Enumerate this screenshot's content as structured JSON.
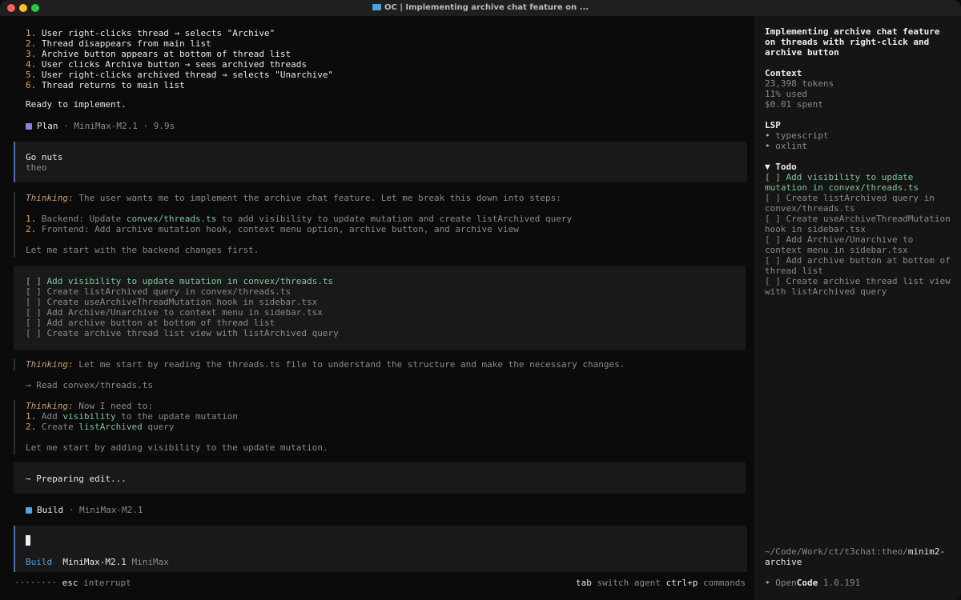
{
  "window": {
    "title": "OC | Implementing archive chat feature on ..."
  },
  "steps": [
    {
      "n": "1.",
      "t": "User right-clicks thread → selects \"Archive\""
    },
    {
      "n": "2.",
      "t": "Thread disappears from main list"
    },
    {
      "n": "3.",
      "t": "Archive button appears at bottom of thread list"
    },
    {
      "n": "4.",
      "t": "User clicks Archive button → sees archived threads"
    },
    {
      "n": "5.",
      "t": "User right-clicks archived thread → selects \"Unarchive\""
    },
    {
      "n": "6.",
      "t": "Thread returns to main list"
    }
  ],
  "ready": "Ready to implement.",
  "plan_meta": {
    "label": "Plan",
    "sep": " · ",
    "model": "MiniMax-M2.1",
    "time": " · 9.9s"
  },
  "user_msg": {
    "text": "Go nuts",
    "author": "theo"
  },
  "thinking1": {
    "prefix": "Thinking:",
    "text": " The user wants me to implement the archive chat feature. Let me break this down into steps:",
    "s1_num": "1.",
    "s1_a": " Backend: Update ",
    "s1_code": "convex/threads.ts",
    "s1_b": " to add visibility to update mutation and create listArchived query",
    "s2_num": "2.",
    "s2_text": " Frontend: Add archive mutation hook, context menu option, archive button, and archive view",
    "tail": "Let me start with the backend changes first."
  },
  "todos_main": [
    "[ ] Add visibility to update mutation in convex/threads.ts",
    "[ ] Create listArchived query in convex/threads.ts",
    "[ ] Create useArchiveThreadMutation hook in sidebar.tsx",
    "[ ] Add Archive/Unarchive to context menu in sidebar.tsx",
    "[ ] Add archive button at bottom of thread list",
    "[ ] Create archive thread list view with listArchived query"
  ],
  "thinking2": {
    "prefix": "Thinking:",
    "text": " Let me start by reading the threads.ts file to understand the structure and make the necessary changes."
  },
  "read_line": "→ Read convex/threads.ts",
  "thinking3": {
    "prefix": "Thinking:",
    "text": " Now I need to:",
    "s1_num": "1.",
    "s1_a": " Add ",
    "s1_code": "visibility",
    "s1_b": " to the update mutation",
    "s2_num": "2.",
    "s2_a": " Create ",
    "s2_code": "listArchived",
    "s2_b": " query",
    "tail": "Let me start by adding visibility to the update mutation."
  },
  "preparing": "~ Preparing edit...",
  "build_meta": {
    "label": "Build",
    "sep": " · ",
    "model": "MiniMax-M2.1"
  },
  "input": {
    "mode": "Build",
    "model": "MiniMax-M2.1",
    "provider": "MiniMax"
  },
  "footer": {
    "dots": "········",
    "esc_key": "esc",
    "esc_label": " interrupt",
    "tab_key": "tab",
    "tab_label": " switch agent",
    "cmd_key": "ctrl+p",
    "cmd_label": " commands"
  },
  "sidebar": {
    "title": "Implementing archive chat feature on threads with right-click and archive button",
    "context_heading": "Context",
    "tokens": "23,398 tokens",
    "used": "11% used",
    "spent": "$0.01 spent",
    "lsp_heading": "LSP",
    "lsp_items": [
      "typescript",
      "oxlint"
    ],
    "todo_heading": "▼ Todo",
    "todos": [
      "[ ] Add visibility to update mutation in convex/threads.ts",
      "[ ] Create listArchived query in convex/threads.ts",
      "[ ] Create useArchiveThreadMutation hook in sidebar.tsx",
      "[ ] Add Archive/Unarchive to context menu in sidebar.tsx",
      "[ ] Add archive button at bottom of thread list",
      "[ ] Create archive thread list view with listArchived query"
    ],
    "path_prefix": "~/Code/Work/ct/t3chat:theo/",
    "path_branch": "minim2-archive",
    "app_open": "Open",
    "app_code": "Code",
    "version": " 1.0.191"
  },
  "colors": {
    "accent_blue": "#5aa0e8",
    "plan_purple": "#9b7bd8",
    "todo_green": "#7ec699",
    "number_orange": "#e0a35f"
  }
}
